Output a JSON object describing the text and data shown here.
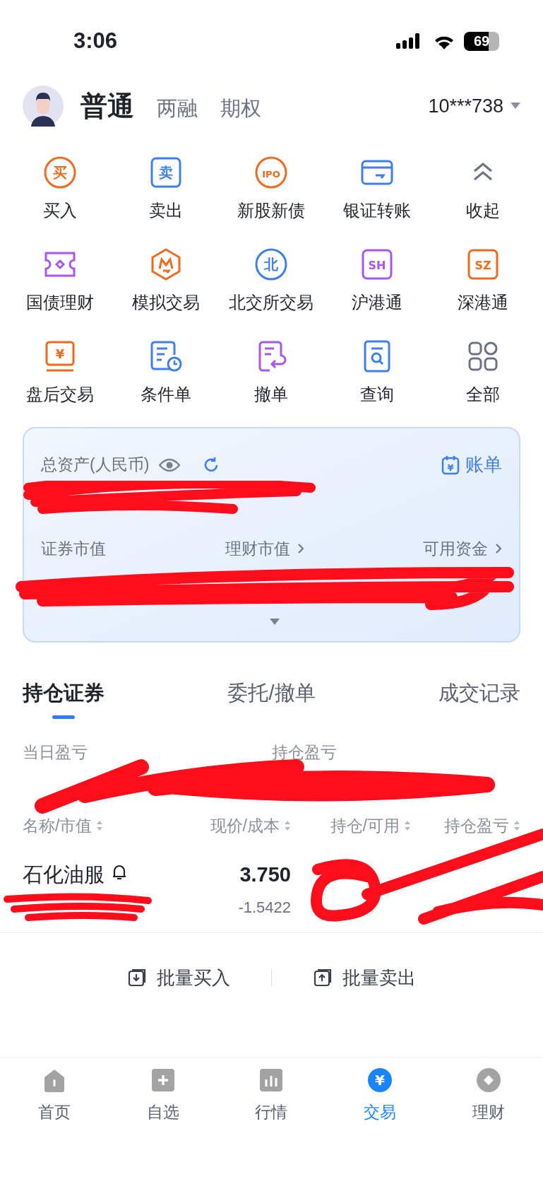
{
  "status_bar": {
    "time": "3:06",
    "battery": "69"
  },
  "account_tabs": [
    {
      "label": "普通",
      "selected": true
    },
    {
      "label": "两融",
      "selected": false
    },
    {
      "label": "期权",
      "selected": false
    }
  ],
  "account_number": "10***738",
  "shortcuts": [
    {
      "label": "买入",
      "kind": "circle",
      "glyph": "买",
      "color": "#f06a1d"
    },
    {
      "label": "卖出",
      "kind": "square",
      "glyph": "卖",
      "color": "#3d7ef0"
    },
    {
      "label": "新股新债",
      "kind": "circle",
      "glyph": "IPO",
      "color": "#f06a1d"
    },
    {
      "label": "银证转账",
      "kind": "card",
      "color": "#3d7ef0"
    },
    {
      "label": "收起",
      "kind": "collapse",
      "color": "#6b7280"
    },
    {
      "label": "国债理财",
      "kind": "ticket",
      "color": "#a855f7"
    },
    {
      "label": "模拟交易",
      "kind": "hexagon",
      "color": "#f06a1d"
    },
    {
      "label": "北交所交易",
      "kind": "circle",
      "glyph": "北",
      "color": "#3d7ef0"
    },
    {
      "label": "沪港通",
      "kind": "square",
      "glyph": "SH",
      "color": "#a855f7"
    },
    {
      "label": "深港通",
      "kind": "square",
      "glyph": "SZ",
      "color": "#f06a1d"
    },
    {
      "label": "盘后交易",
      "kind": "screen",
      "glyph": "¥",
      "color": "#f06a1d"
    },
    {
      "label": "条件单",
      "kind": "clockdoc",
      "color": "#3d7ef0"
    },
    {
      "label": "撤单",
      "kind": "undodoc",
      "color": "#a855f7"
    },
    {
      "label": "查询",
      "kind": "searchdoc",
      "color": "#3d7ef0"
    },
    {
      "label": "全部",
      "kind": "grid",
      "color": "#6b7280"
    }
  ],
  "asset_card": {
    "title": "总资产(人民币)",
    "bill": {
      "label": "账单",
      "glyph": "¥"
    },
    "fields": [
      {
        "label": "证券市值",
        "link": false
      },
      {
        "label": "理财市值",
        "link": true
      },
      {
        "label": "可用资金",
        "link": true
      }
    ]
  },
  "position_tabs": [
    {
      "label": "持仓证券",
      "selected": true
    },
    {
      "label": "委托/撤单",
      "selected": false
    },
    {
      "label": "成交记录",
      "selected": false
    }
  ],
  "pnl_labels": [
    "当日盈亏",
    "持仓盈亏"
  ],
  "table": {
    "columns": [
      "名称/市值",
      "现价/成本",
      "持仓/可用",
      "持仓盈亏"
    ],
    "rows": [
      {
        "name": "石化油服",
        "alert": true,
        "price": "3.750",
        "cost": "-1.5422"
      }
    ]
  },
  "batch_buttons": [
    {
      "label": "批量买入",
      "kind": "buy"
    },
    {
      "label": "批量卖出",
      "kind": "sell"
    }
  ],
  "bottom_nav": [
    {
      "label": "首页",
      "kind": "home",
      "selected": false
    },
    {
      "label": "自选",
      "kind": "plus",
      "selected": false
    },
    {
      "label": "行情",
      "kind": "bars",
      "selected": false
    },
    {
      "label": "交易",
      "kind": "yen",
      "glyph": "¥",
      "selected": true
    },
    {
      "label": "理财",
      "kind": "diamond",
      "selected": false
    }
  ]
}
